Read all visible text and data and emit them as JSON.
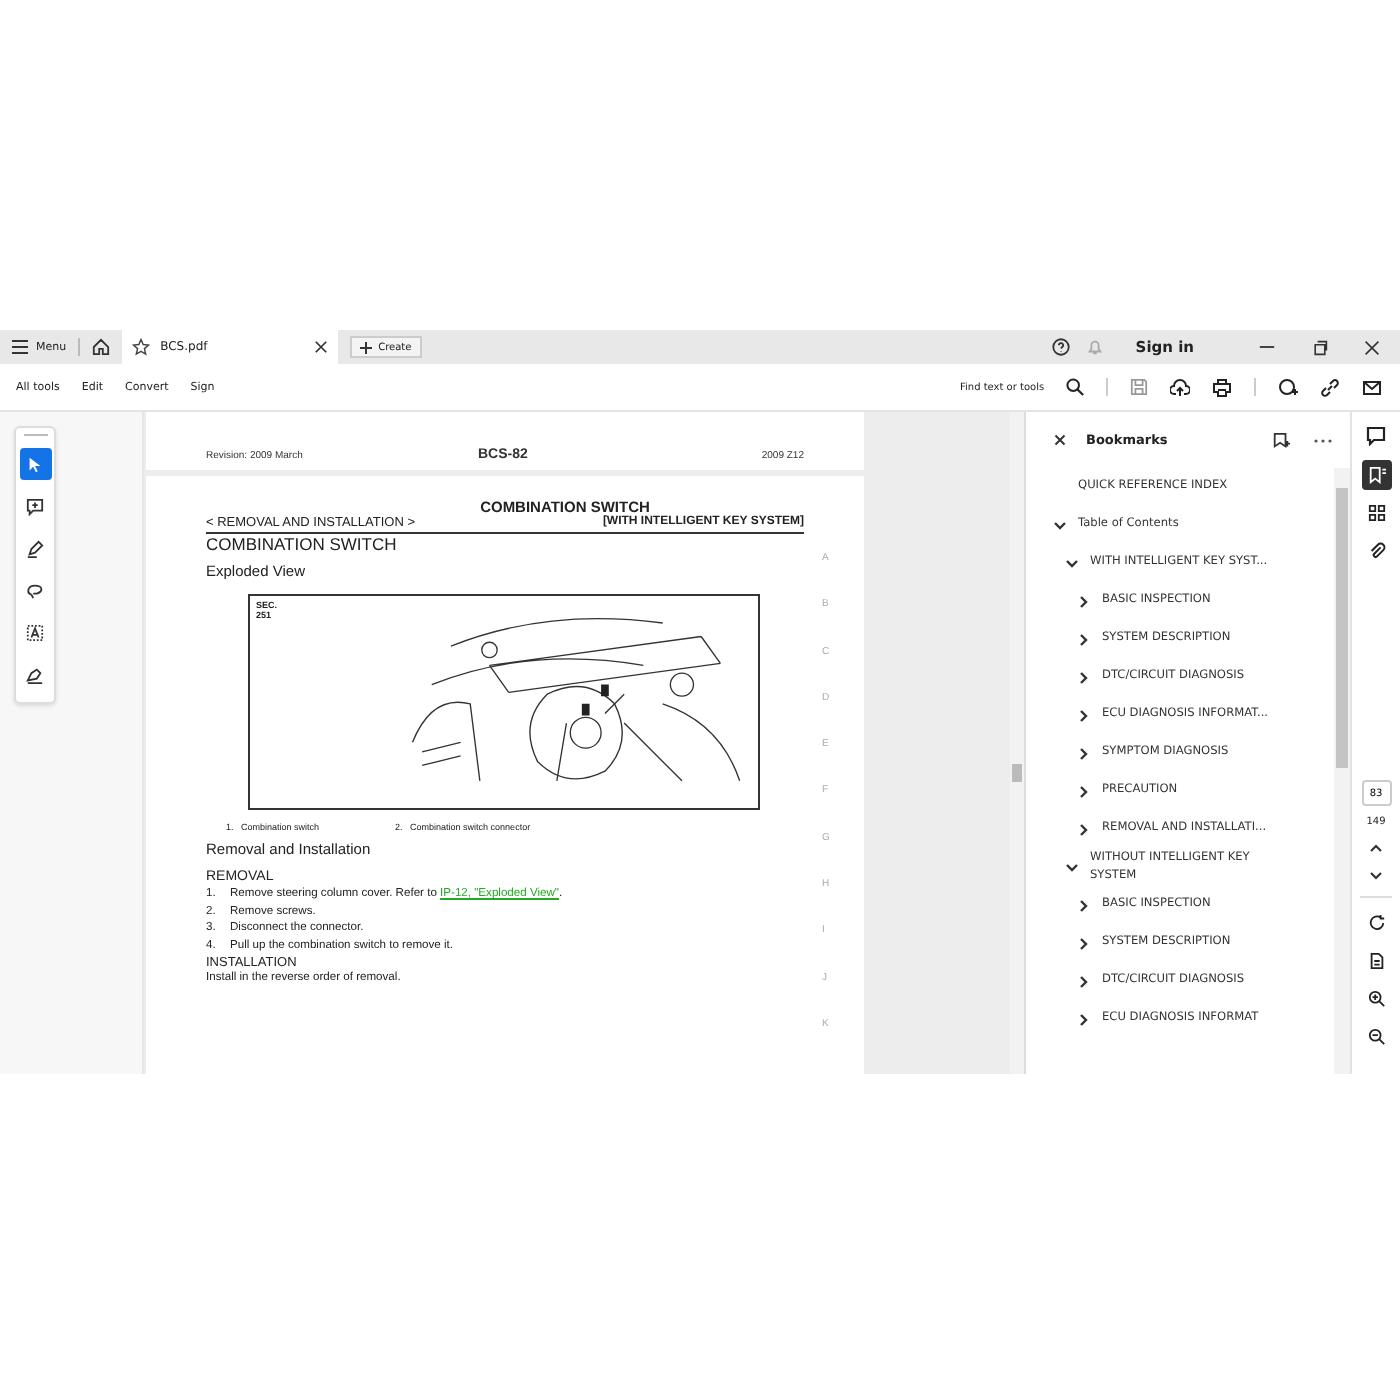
{
  "tab_bar": {
    "menu_label": "Menu",
    "tabs": [
      {
        "title": "BCS.pdf",
        "selected": true
      }
    ],
    "create_label": "Create",
    "sign_in": "Sign in"
  },
  "toolbar": {
    "menus": [
      "All tools",
      "Edit",
      "Convert",
      "Sign"
    ],
    "search": {
      "placeholder": "Find text or tools"
    }
  },
  "tools": [
    {
      "kind": "select",
      "selected": true
    },
    {
      "kind": "comment",
      "selected": false
    },
    {
      "kind": "draw",
      "selected": false
    },
    {
      "kind": "lasso",
      "selected": false
    },
    {
      "kind": "text",
      "selected": false
    },
    {
      "kind": "sign",
      "selected": false
    }
  ],
  "page_top": {
    "revision": "Revision: 2009 March",
    "page_code": "BCS-82",
    "model": "2009 Z12"
  },
  "page": {
    "title": "COMBINATION SWITCH",
    "breadcrumb": "< REMOVAL AND INSTALLATION >",
    "variant": "[WITH INTELLIGENT KEY SYSTEM]",
    "section": "COMBINATION SWITCH",
    "subsection": "Exploded View",
    "figure": {
      "label": "SEC. 251"
    },
    "legend": [
      {
        "number": "1.",
        "text": "Combination switch"
      },
      {
        "number": "2.",
        "text": "Combination switch connector"
      }
    ],
    "procedure_title": "Removal and Installation",
    "removal_heading": "REMOVAL",
    "steps": [
      {
        "number": "1.",
        "text": "Remove steering column cover. Refer to ",
        "link": "IP-12, \"Exploded View\"",
        "after": "."
      },
      {
        "number": "2.",
        "text": "Remove screws."
      },
      {
        "number": "3.",
        "text": "Disconnect the connector."
      },
      {
        "number": "4.",
        "text": "Pull up the combination switch to remove it."
      }
    ],
    "installation_heading": "INSTALLATION",
    "installation_text": "Install in the reverse order of removal.",
    "margin_letters": [
      "A",
      "B",
      "C",
      "D",
      "E",
      "F",
      "G",
      "H",
      "I",
      "J",
      "K"
    ]
  },
  "bookmarks": {
    "title": "Bookmarks",
    "items": [
      {
        "label": "QUICK REFERENCE INDEX"
      },
      {
        "label": "Table of Contents",
        "expanded": true,
        "children": [
          {
            "label": "WITH INTELLIGENT KEY SYST...",
            "expanded": true,
            "children": [
              {
                "label": "BASIC INSPECTION",
                "expanded": false
              },
              {
                "label": "SYSTEM DESCRIPTION",
                "expanded": false
              },
              {
                "label": "DTC/CIRCUIT DIAGNOSIS",
                "expanded": false
              },
              {
                "label": "ECU DIAGNOSIS INFORMAT...",
                "expanded": false
              },
              {
                "label": "SYMPTOM DIAGNOSIS",
                "expanded": false
              },
              {
                "label": "PRECAUTION",
                "expanded": false
              },
              {
                "label": "REMOVAL AND INSTALLATI...",
                "expanded": false
              }
            ]
          },
          {
            "label": "WITHOUT INTELLIGENT KEY SYSTEM",
            "expanded": true,
            "children": [
              {
                "label": "BASIC INSPECTION",
                "expanded": false
              },
              {
                "label": "SYSTEM DESCRIPTION",
                "expanded": false
              },
              {
                "label": "DTC/CIRCUIT DIAGNOSIS",
                "expanded": false
              },
              {
                "label": "ECU DIAGNOSIS INFORMAT",
                "expanded": false
              }
            ]
          }
        ]
      }
    ]
  },
  "page_nav": {
    "current": "83",
    "total": "149"
  }
}
